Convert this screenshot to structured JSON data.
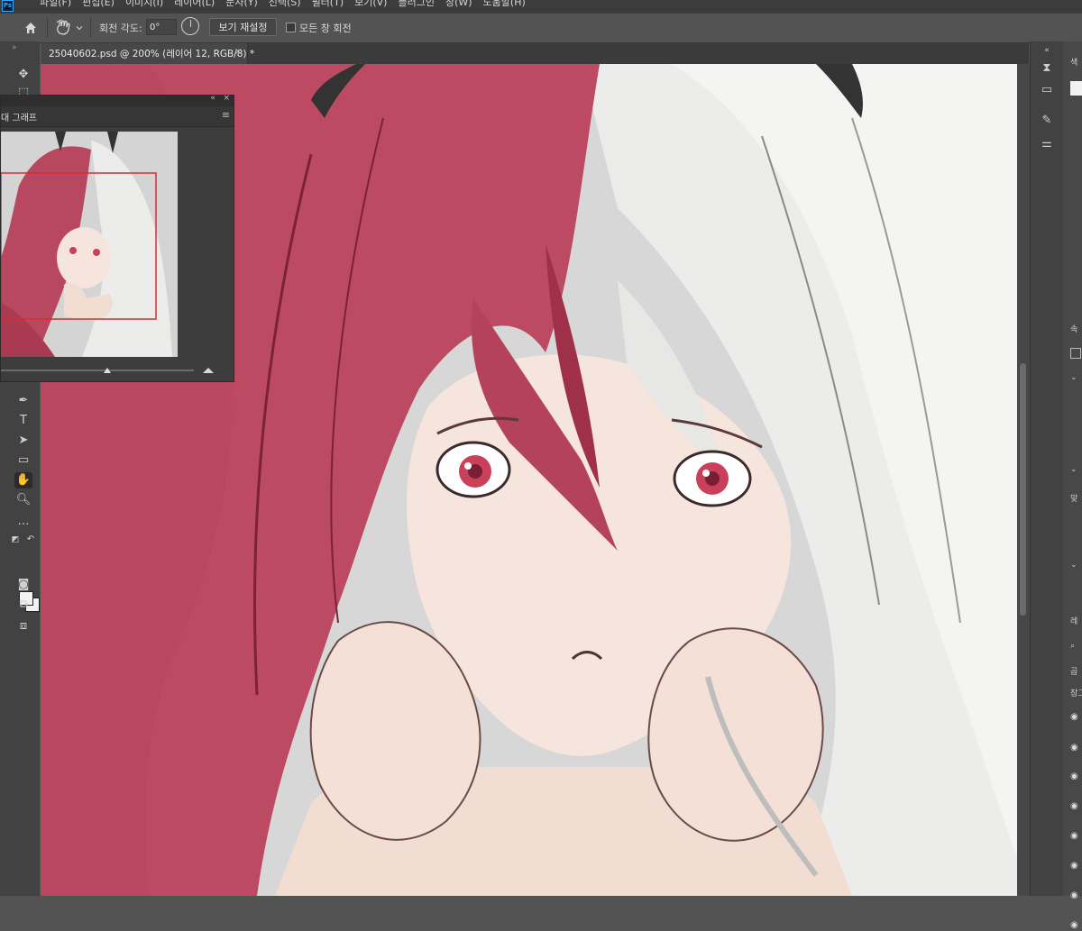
{
  "menubar": {
    "app_logo": "Ps",
    "items": [
      "파일(F)",
      "편집(E)",
      "이미지(I)",
      "레이어(L)",
      "문자(Y)",
      "선택(S)",
      "필터(T)",
      "보기(V)",
      "플러그인",
      "창(W)",
      "도움말(H)"
    ]
  },
  "options": {
    "home_icon": "home-icon",
    "tool_icon": "rotate-view-hand-icon",
    "angle_label": "회전 각도:",
    "angle_value": "0°",
    "reset_view_label": "보기 재설정",
    "rotate_all_label": "모든 창 회전",
    "rotate_all_checked": false
  },
  "document": {
    "tab_title": "25040602.psd @ 200% (레이어 12, RGB/8) *",
    "close_glyph": "×"
  },
  "navigator": {
    "title": "대 그래프",
    "collapse_glyph": "«",
    "close_glyph": "×",
    "zoom_percent": 0.55
  },
  "right_panel": {
    "labels": [
      "색",
      "속",
      "맞",
      "레",
      "곱",
      "잠그"
    ],
    "layer_rows": 8
  },
  "colors": {
    "hair_red": "#b8485f",
    "hair_white": "#ececec",
    "skin": "#f6e4dc",
    "iris": "#c9405a",
    "nav_frame": "#e0282f"
  }
}
